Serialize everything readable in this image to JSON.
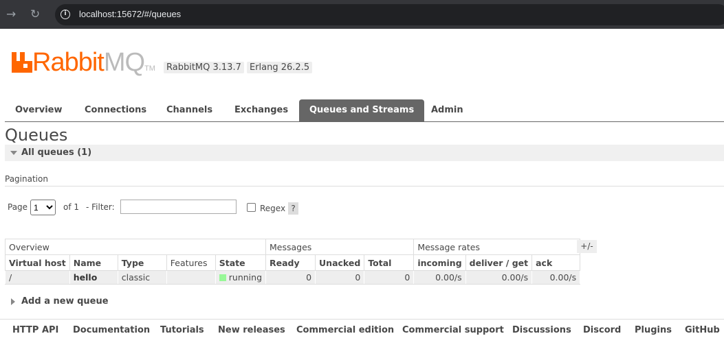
{
  "browser": {
    "url": "localhost:15672/#/queues"
  },
  "header": {
    "logo_brand": "Rabbit",
    "logo_mq": "MQ",
    "logo_tm": "TM",
    "version": "RabbitMQ 3.13.7",
    "erlang": "Erlang 26.2.5"
  },
  "tabs": [
    {
      "label": "Overview"
    },
    {
      "label": "Connections"
    },
    {
      "label": "Channels"
    },
    {
      "label": "Exchanges"
    },
    {
      "label": "Queues and Streams",
      "active": true
    },
    {
      "label": "Admin"
    }
  ],
  "page": {
    "title": "Queues",
    "section": "All queues (1)",
    "pagination_label": "Pagination",
    "page_label": "Page",
    "page_value": "1",
    "of_label": "of 1",
    "filter_label": "- Filter:",
    "filter_value": "",
    "regex_label": "Regex",
    "help": "?",
    "toggle_columns": "+/-",
    "add_queue": "Add a new queue"
  },
  "table": {
    "groups": [
      "Overview",
      "Messages",
      "Message rates"
    ],
    "columns": [
      "Virtual host",
      "Name",
      "Type",
      "Features",
      "State",
      "Ready",
      "Unacked",
      "Total",
      "incoming",
      "deliver / get",
      "ack"
    ],
    "rows": [
      {
        "vhost": "/",
        "name": "hello",
        "type": "classic",
        "features": "",
        "state": "running",
        "ready": "0",
        "unacked": "0",
        "total": "0",
        "incoming": "0.00/s",
        "deliver": "0.00/s",
        "ack": "0.00/s"
      }
    ]
  },
  "footer": [
    "HTTP API",
    "Documentation",
    "Tutorials",
    "New releases",
    "Commercial edition",
    "Commercial support",
    "Discussions",
    "Discord",
    "Plugins",
    "GitHub"
  ],
  "colors": {
    "brand": "#ff6600",
    "active_tab": "#666666",
    "running": "#98f898"
  }
}
